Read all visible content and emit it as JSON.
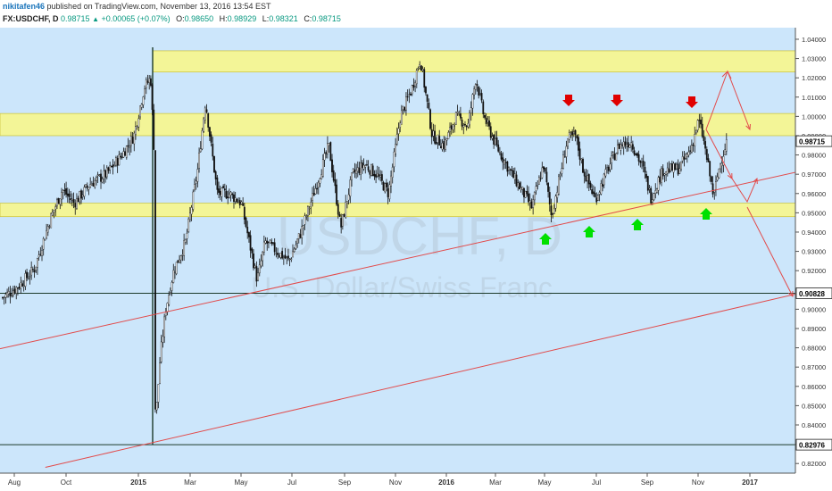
{
  "header": {
    "author": "nikitafen46",
    "published_text": "published on TradingView.com, November 13, 2016 13:54 EST",
    "symbol": "FX:USDCHF, D",
    "last": "0.98715",
    "change": "+0.00065 (+0.07%)",
    "o_label": "O:",
    "o_value": "0.98650",
    "h_label": "H:",
    "h_value": "0.98929",
    "l_label": "L:",
    "l_value": "0.98321",
    "c_label": "C:",
    "c_value": "0.98715"
  },
  "watermark": {
    "symbol": "USDCHF, D",
    "name": "U.S. Dollar/Swiss Franc"
  },
  "chart_data": {
    "type": "candlestick",
    "ylim": [
      0.815,
      1.046
    ],
    "y_ticks": [
      "1.04000",
      "1.03000",
      "1.02000",
      "1.01000",
      "1.00000",
      "0.99000",
      "0.98000",
      "0.97000",
      "0.96000",
      "0.95000",
      "0.94000",
      "0.93000",
      "0.92000",
      "0.91000",
      "0.90000",
      "0.89000",
      "0.88000",
      "0.87000",
      "0.86000",
      "0.85000",
      "0.84000",
      "0.83000",
      "0.82000"
    ],
    "x_ticks": [
      "Aug",
      "Oct",
      "2015",
      "Mar",
      "May",
      "Jul",
      "Sep",
      "Nov",
      "2016",
      "Mar",
      "May",
      "Jul",
      "Sep",
      "Nov",
      "2017"
    ],
    "price_labels": [
      {
        "value": 0.98715,
        "text": "0.98715",
        "color": "#000000"
      },
      {
        "value": 0.90828,
        "text": "0.90828",
        "color": "#000000"
      },
      {
        "value": 0.82976,
        "text": "0.82976",
        "color": "#000000"
      }
    ],
    "horizontal_lines": [
      0.90828,
      0.82976
    ],
    "zones": [
      {
        "from": 1.023,
        "to": 1.034,
        "color": "#f3f597"
      },
      {
        "from": 0.99,
        "to": 1.0015,
        "color": "#f3f597"
      },
      {
        "from": 0.948,
        "to": 0.955,
        "color": "#f3f597"
      }
    ],
    "trend_lines": [
      {
        "x1": 0,
        "y1": 0.8795,
        "x2": 1,
        "y2": 0.971,
        "color": "#e24b4b"
      },
      {
        "x1": 0.057,
        "y1": 0.818,
        "x2": 1,
        "y2": 0.9078,
        "color": "#e24b4b"
      }
    ],
    "keypoints": [
      [
        0.0,
        0.906
      ],
      [
        0.02,
        0.912
      ],
      [
        0.04,
        0.921
      ],
      [
        0.06,
        0.947
      ],
      [
        0.075,
        0.962
      ],
      [
        0.09,
        0.955
      ],
      [
        0.11,
        0.965
      ],
      [
        0.13,
        0.97
      ],
      [
        0.15,
        0.98
      ],
      [
        0.165,
        0.99
      ],
      [
        0.178,
        1.015
      ],
      [
        0.186,
        1.02
      ],
      [
        0.19,
        0.985
      ],
      [
        0.192,
        0.84
      ],
      [
        0.198,
        0.875
      ],
      [
        0.205,
        0.9
      ],
      [
        0.215,
        0.92
      ],
      [
        0.23,
        0.935
      ],
      [
        0.245,
        0.972
      ],
      [
        0.255,
        1.008
      ],
      [
        0.262,
        0.985
      ],
      [
        0.27,
        0.96
      ],
      [
        0.285,
        0.96
      ],
      [
        0.3,
        0.955
      ],
      [
        0.31,
        0.935
      ],
      [
        0.32,
        0.915
      ],
      [
        0.33,
        0.935
      ],
      [
        0.345,
        0.93
      ],
      [
        0.36,
        0.925
      ],
      [
        0.375,
        0.94
      ],
      [
        0.395,
        0.965
      ],
      [
        0.41,
        0.985
      ],
      [
        0.425,
        0.942
      ],
      [
        0.44,
        0.97
      ],
      [
        0.455,
        0.975
      ],
      [
        0.47,
        0.97
      ],
      [
        0.485,
        0.96
      ],
      [
        0.5,
        1.0
      ],
      [
        0.515,
        1.015
      ],
      [
        0.525,
        1.03
      ],
      [
        0.54,
        0.99
      ],
      [
        0.555,
        0.985
      ],
      [
        0.57,
        1.0
      ],
      [
        0.585,
        0.995
      ],
      [
        0.595,
        1.02
      ],
      [
        0.605,
        1.0
      ],
      [
        0.62,
        0.985
      ],
      [
        0.64,
        0.97
      ],
      [
        0.655,
        0.96
      ],
      [
        0.665,
        0.953
      ],
      [
        0.68,
        0.975
      ],
      [
        0.69,
        0.948
      ],
      [
        0.7,
        0.968
      ],
      [
        0.71,
        0.988
      ],
      [
        0.72,
        0.99
      ],
      [
        0.73,
        0.972
      ],
      [
        0.745,
        0.957
      ],
      [
        0.76,
        0.972
      ],
      [
        0.775,
        0.985
      ],
      [
        0.79,
        0.987
      ],
      [
        0.805,
        0.973
      ],
      [
        0.815,
        0.958
      ],
      [
        0.83,
        0.972
      ],
      [
        0.85,
        0.973
      ],
      [
        0.865,
        0.983
      ],
      [
        0.875,
        0.998
      ],
      [
        0.88,
        0.99
      ],
      [
        0.888,
        0.972
      ],
      [
        0.894,
        0.958
      ],
      [
        0.9,
        0.972
      ],
      [
        0.91,
        0.987
      ]
    ]
  }
}
